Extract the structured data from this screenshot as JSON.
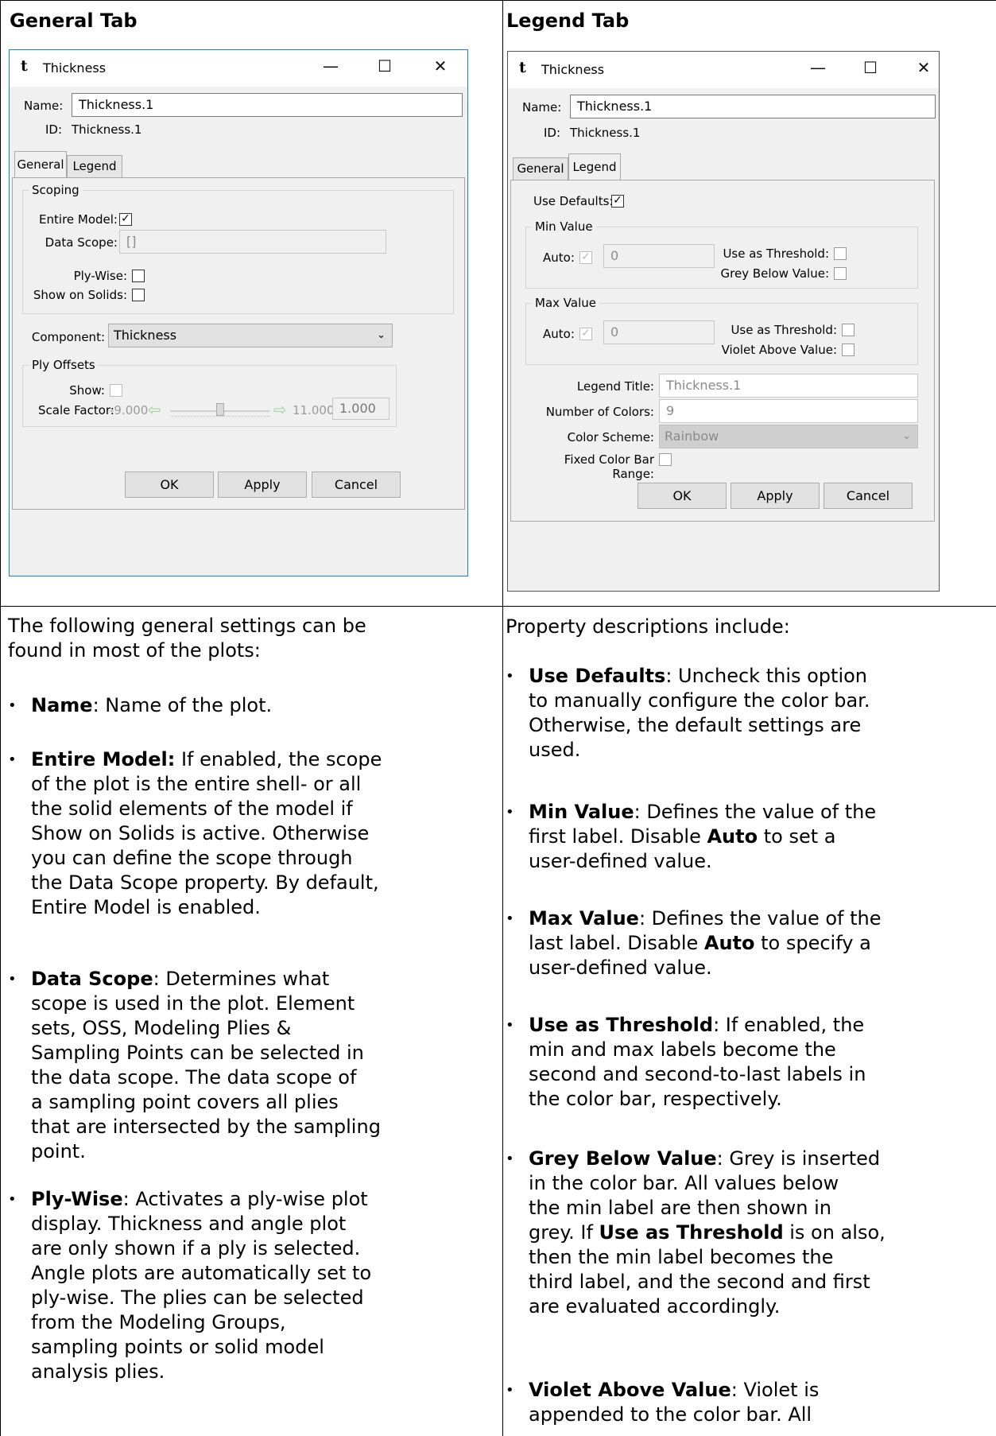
{
  "headers": {
    "left": "General Tab",
    "right": "Legend Tab"
  },
  "general_dialog": {
    "title": "Thickness",
    "icon": "t-icon",
    "window_buttons": {
      "minimize": "—",
      "maximize": "☐",
      "close": "✕"
    },
    "name_label": "Name:",
    "name_value": "Thickness.1",
    "id_label": "ID:",
    "id_value": "Thickness.1",
    "tabs": [
      "General",
      "Legend"
    ],
    "scoping_title": "Scoping",
    "entire_model_label": "Entire Model:",
    "entire_model_checked": "✓",
    "data_scope_label": "Data Scope:",
    "data_scope_value": "[]",
    "ply_wise_label": "Ply-Wise:",
    "show_on_solids_label": "Show on Solids:",
    "component_label": "Component:",
    "component_value": "Thickness",
    "ply_offsets_title": "Ply Offsets",
    "show_label": "Show:",
    "scale_factor_label": "Scale Factor:",
    "scale_min": "-9.000",
    "scale_max": "11.000",
    "scale_value": "1.000",
    "ok": "OK",
    "apply": "Apply",
    "cancel": "Cancel"
  },
  "legend_dialog": {
    "title": "Thickness",
    "name_label": "Name:",
    "name_value": "Thickness.1",
    "id_label": "ID:",
    "id_value": "Thickness.1",
    "tabs": [
      "General",
      "Legend"
    ],
    "use_defaults_label": "Use Defaults:",
    "use_defaults_checked": "✓",
    "min_value_title": "Min Value",
    "auto_label": "Auto:",
    "auto_checked": "✓",
    "min_value": "0",
    "use_as_threshold_label": "Use as Threshold:",
    "grey_below_label": "Grey Below Value:",
    "max_value_title": "Max Value",
    "max_value": "0",
    "violet_above_label": "Violet Above Value:",
    "legend_title_label": "Legend Title:",
    "legend_title_value": "Thickness.1",
    "num_colors_label": "Number of Colors:",
    "num_colors_value": "9",
    "color_scheme_label": "Color Scheme:",
    "color_scheme_value": "Rainbow",
    "fixed_range_label": "Fixed Color Bar Range:",
    "ok": "OK",
    "apply": "Apply",
    "cancel": "Cancel"
  },
  "left_text": {
    "intro_1": "The following general settings can be",
    "intro_2": "found in most of the plots:",
    "bullets": [
      {
        "term": "Name",
        "lines": [
          ": Name of the plot."
        ]
      },
      {
        "term": "Entire Model:",
        "lines": [
          " If enabled, the scope",
          "of the plot is the entire shell- or all",
          "the solid elements of the model if",
          "Show on Solids is active. Otherwise",
          "you can define the scope through",
          "the Data Scope property. By default,",
          "Entire Model is enabled."
        ]
      },
      {
        "term": "Data Scope",
        "lines": [
          ": Determines what",
          "scope is used in the plot. Element",
          "sets, OSS, Modeling Plies &",
          "Sampling Points can be selected in",
          "the data scope. The data scope of",
          "a sampling point covers all plies",
          "that are intersected by the sampling",
          "point."
        ]
      },
      {
        "term": "Ply-Wise",
        "lines": [
          ": Activates a ply-wise plot",
          "display. Thickness and angle plot",
          "are only shown if a ply is selected.",
          "Angle plots are automatically set to",
          "ply-wise. The plies can be selected",
          "from the Modeling Groups,",
          "sampling points or solid model",
          "analysis plies."
        ]
      }
    ]
  },
  "right_text": {
    "intro": "Property descriptions include:",
    "use_defaults": {
      "term": "Use Defaults",
      "l1": ": Uncheck this option",
      "l2": "to manually configure the color bar.",
      "l3": "Otherwise, the default settings are",
      "l4": "used."
    },
    "min_value": {
      "term": "Min Value",
      "l1": ": Defines the value of the",
      "l2a": "first label. Disable ",
      "l2b": "Auto",
      "l2c": " to set a",
      "l3": "user-defined value."
    },
    "max_value": {
      "term": "Max Value",
      "l1": ": Defines the value of the",
      "l2a": "last label. Disable ",
      "l2b": "Auto",
      "l2c": " to specify a",
      "l3": "user-defined value."
    },
    "threshold": {
      "term": "Use as Threshold",
      "l1": ": If enabled, the",
      "l2": "min and max labels become the",
      "l3": "second and second-to-last labels in",
      "l4": "the color bar, respectively."
    },
    "grey": {
      "term": "Grey Below Value",
      "l1": ": Grey is inserted",
      "l2": "in the color bar. All values below",
      "l3": "the min label are then shown in",
      "l4a": "grey. If ",
      "l4b": "Use as Threshold",
      "l4c": " is on also,",
      "l5": "then the min label becomes the",
      "l6": "third label, and the second and first",
      "l7": "are evaluated accordingly."
    },
    "violet": {
      "term": "Violet Above Value",
      "l1": ": Violet is",
      "l2": "appended to the color bar. All"
    }
  }
}
